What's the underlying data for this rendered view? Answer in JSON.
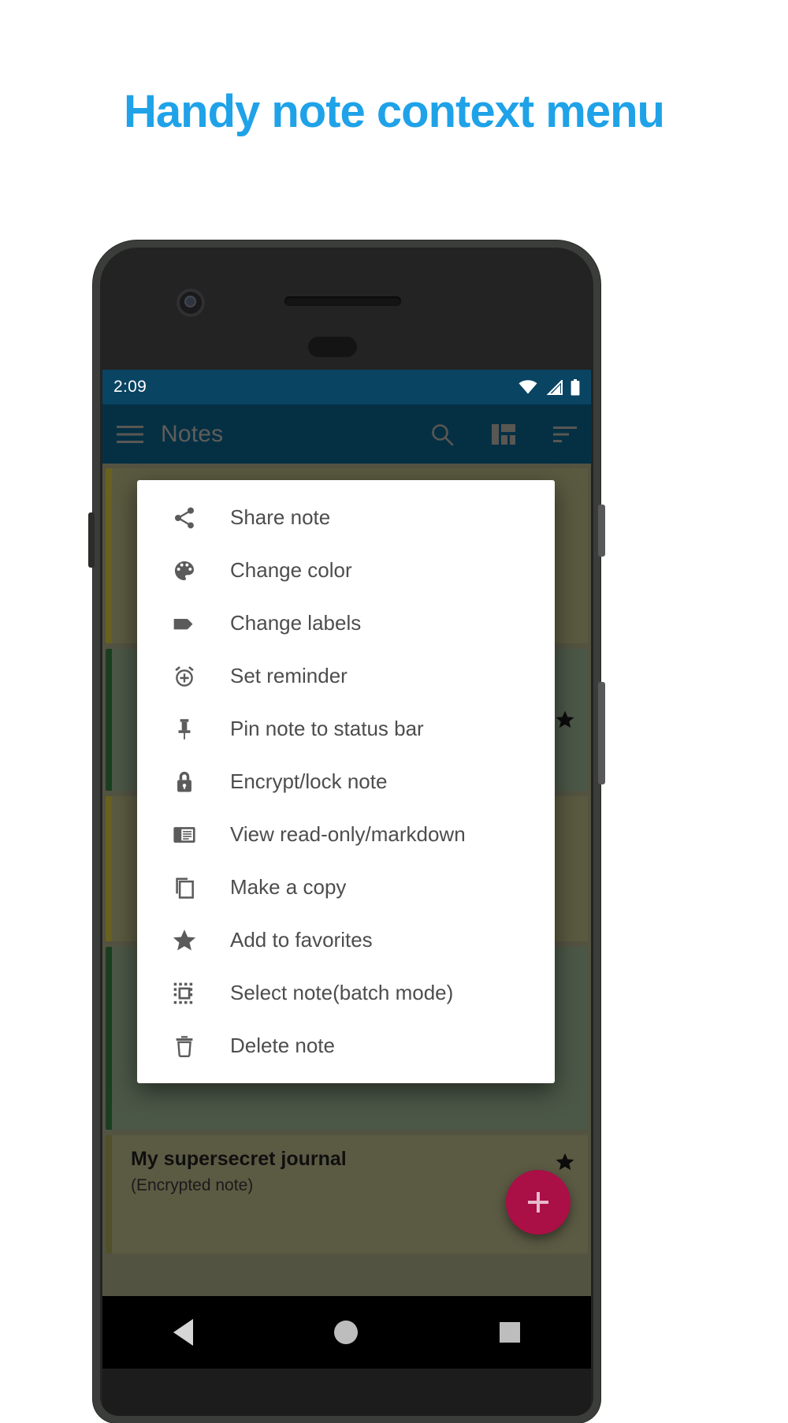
{
  "headline": "Handy note context menu",
  "brand": {
    "accent_blue": "#1fa2e8",
    "toolbar_blue": "#0a5476",
    "status_blue": "#0a4463",
    "fab_pink": "#aa0f46"
  },
  "status_bar": {
    "time": "2:09",
    "icons": [
      "wifi-icon",
      "cell-signal-icon",
      "battery-icon"
    ]
  },
  "toolbar": {
    "menu_icon": "hamburger-menu-icon",
    "title": "Notes",
    "actions": [
      {
        "icon": "search-icon",
        "label": "Search"
      },
      {
        "icon": "grid-view-icon",
        "label": "Change layout"
      },
      {
        "icon": "sort-icon",
        "label": "Sort"
      }
    ]
  },
  "context_menu": {
    "items": [
      {
        "icon": "share-icon",
        "label": "Share note"
      },
      {
        "icon": "palette-icon",
        "label": "Change color"
      },
      {
        "icon": "tag-icon",
        "label": "Change labels"
      },
      {
        "icon": "alarm-add-icon",
        "label": "Set reminder"
      },
      {
        "icon": "pushpin-icon",
        "label": "Pin note to status bar"
      },
      {
        "icon": "lock-icon",
        "label": "Encrypt/lock note"
      },
      {
        "icon": "reader-icon",
        "label": "View read-only/markdown"
      },
      {
        "icon": "copy-icon",
        "label": "Make a copy"
      },
      {
        "icon": "star-icon",
        "label": "Add to favorites"
      },
      {
        "icon": "select-all-icon",
        "label": "Select note(batch mode)"
      },
      {
        "icon": "trash-icon",
        "label": "Delete note"
      }
    ]
  },
  "notes": [
    {
      "title": "",
      "body": "",
      "accent": "#b5a738",
      "bg": "#9a9a6e",
      "starred": false
    },
    {
      "title": "",
      "body": "",
      "accent": "#2f6b3a",
      "bg": "#7f9375",
      "starred": true
    },
    {
      "title": "",
      "body": "",
      "accent": "#b5a738",
      "bg": "#9a9a6e",
      "starred": false
    },
    {
      "title": "",
      "body": "",
      "accent": "#2f6b3a",
      "bg": "#7f9375",
      "starred": false
    },
    {
      "title": "My supersecret journal",
      "body": "(Encrypted note)",
      "accent": "#8b8b4a",
      "bg": "#9a9a72",
      "starred": true
    }
  ],
  "fab": {
    "icon": "plus-icon",
    "label": "New note"
  },
  "nav_bar": {
    "back": "back-triangle-icon",
    "home": "home-circle-icon",
    "recents": "recents-square-icon"
  }
}
